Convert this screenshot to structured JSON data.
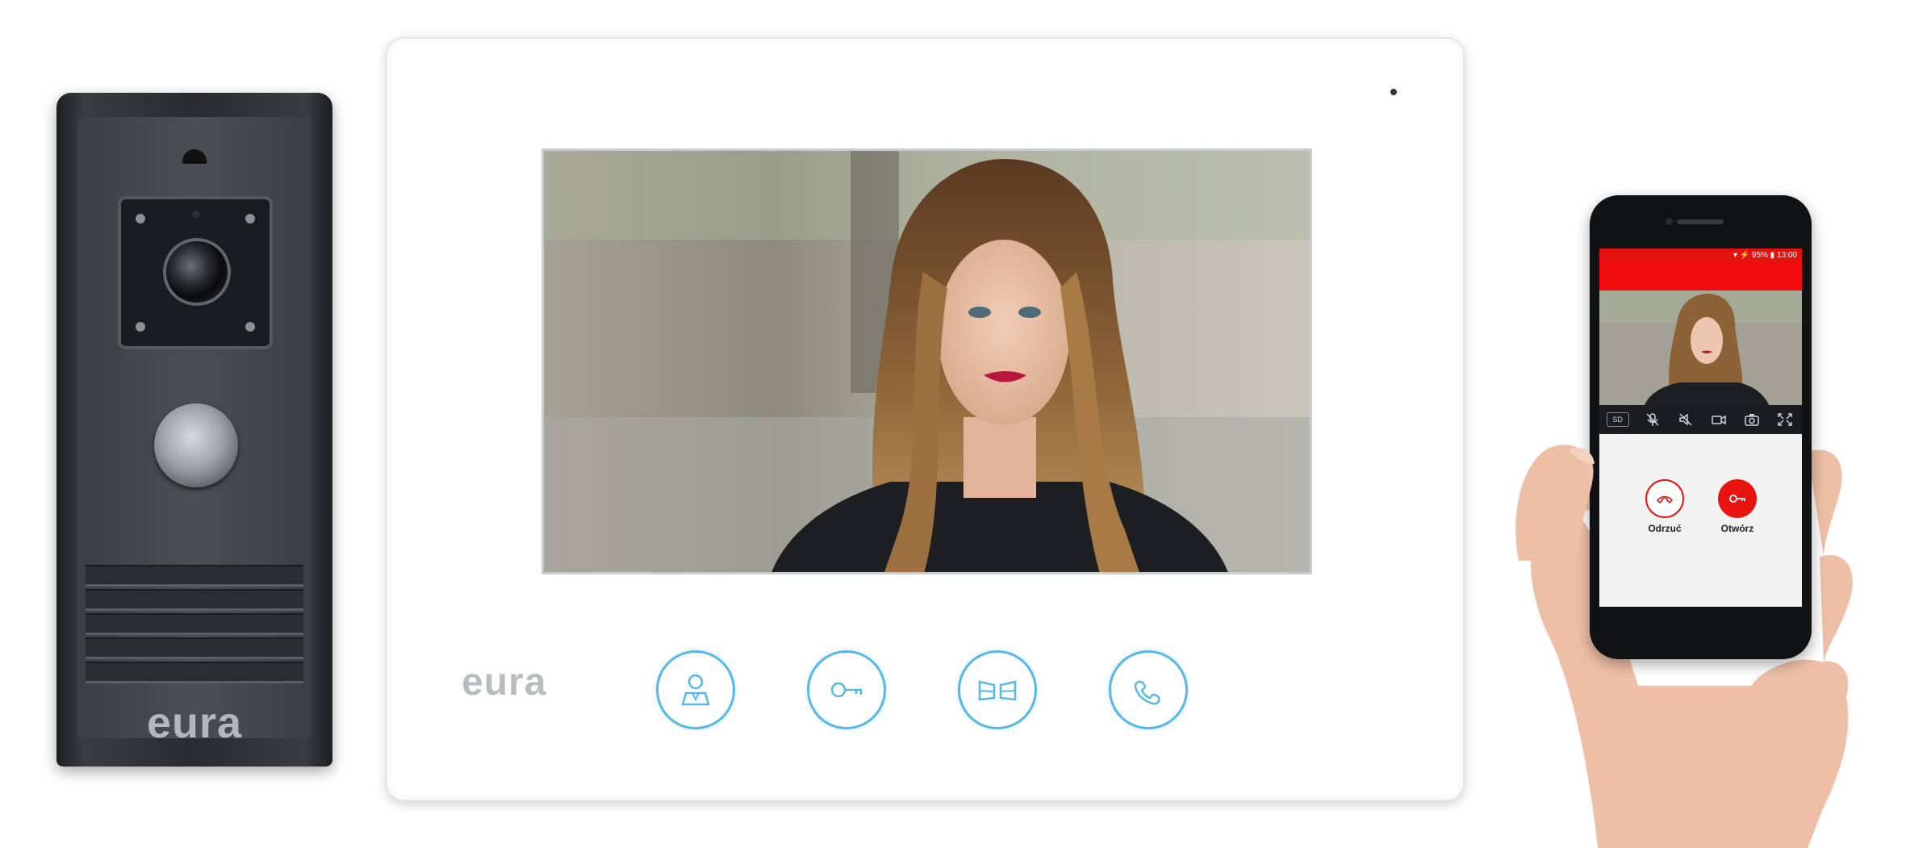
{
  "door_station": {
    "logo": "eura"
  },
  "monitor": {
    "logo": "eura",
    "buttons": [
      {
        "icon": "person-icon"
      },
      {
        "icon": "key-icon"
      },
      {
        "icon": "gate-icon"
      },
      {
        "icon": "handset-icon"
      }
    ]
  },
  "phone": {
    "status_text": "▾ ⚡ 95% ▮ 13:00",
    "toolbar": {
      "quality_label": "SD",
      "items": [
        "mic-muted-icon",
        "speaker-muted-icon",
        "record-video-icon",
        "snapshot-camera-icon",
        "fullscreen-icon"
      ]
    },
    "actions": {
      "reject_label": "Odrzuć",
      "open_label": "Otwórz"
    },
    "colors": {
      "accent": "#f00c0c",
      "accept": "#e8140f"
    }
  },
  "colors": {
    "monitor_button": "#57b8e8",
    "door_station": "#3b3e43"
  }
}
